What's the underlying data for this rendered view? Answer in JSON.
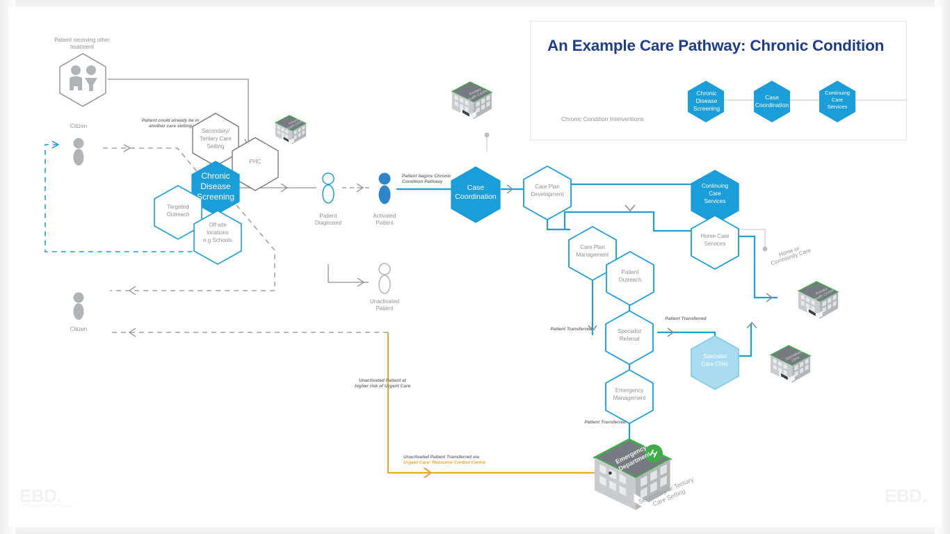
{
  "header": {
    "title": "An Example Care Pathway: Chronic Condition",
    "caption": "Chronic Condition Interventions",
    "hexes": [
      {
        "label": "Chronic\nDisease\nScreening"
      },
      {
        "label": "Case\nCoordination"
      },
      {
        "label": "Continuing\nCare\nServices"
      }
    ]
  },
  "colors": {
    "accent_blue": "#1b9dd9",
    "dark_blue": "#1f3d87",
    "light_blue": "#a9dcf0",
    "grey_line": "#8a8f94",
    "orange": "#f0a52a",
    "green_roof": "#3fae49",
    "text_grey": "#8c9196"
  },
  "nodes": {
    "patient_other_treatment": "Patient receiving other\ntreatment",
    "citizen_top": "Citizen",
    "citizen_bottom": "Citizen",
    "secondary_tertiary": "Secondary/\nTertiary Care\nSetting",
    "phc": "PHC",
    "chronic_disease_screening": "Chronic\nDisease\nScreening",
    "targeted_outreach": "Targeted\nOutreach",
    "off_site": "Off site\nlocations\ne.g Schools",
    "patient_diagnosed": "Patient\nDiagnosed",
    "activated_patient": "Activated\nPatient",
    "unactivated_patient": "Unactivated\nPatient",
    "case_coordination": "Case\nCoordination",
    "care_plan_development": "Care Plan\nDevelopment",
    "care_plan_management": "Care Plan\nManagement",
    "patient_outreach": "Patient\nOutreach",
    "specialist_referral": "Specialist\nReferral",
    "emergency_management": "Emergency\nManagement",
    "specialist_care_clinic": "Specialist\nCare Clinic",
    "continuing_care_services": "Continuing\nCare\nServices",
    "home_care_services": "Home Care\nServices"
  },
  "annotations": {
    "could_already_be": "Patient could already be in\nanother care setting",
    "begins_pathway": "Patient begins Chronic\nCondition Pathway",
    "transferred_1": "Patient Transferred",
    "transferred_2": "Patient Transferred",
    "transferred_3": "Patient Transferred",
    "higher_risk": "Unactivated Patient at\nhigher risk of Urgent Care",
    "urgent_line1": "Unactivated Patient Transferred via",
    "urgent_line2": "Urgent Care: Resource Control Centre",
    "home_or_community": "Home or\nCommunity Care"
  },
  "buildings": {
    "phc_left": "Primary\nHealth Centre",
    "phc_top": "Primary\nHealth Centre",
    "phc_right": "Primary\nHealth Centre",
    "specialised_clinic": "Specialised\nClinic",
    "emergency_department": "Emergency\nDepartment",
    "secondary_tertiary_setting": "Secondary or Tertiary\nCare Setting",
    "helipad": "H"
  },
  "branding": {
    "logo": "EBD",
    "logo_dot": ".",
    "logo_sub": "Co-Evolution By Design"
  }
}
